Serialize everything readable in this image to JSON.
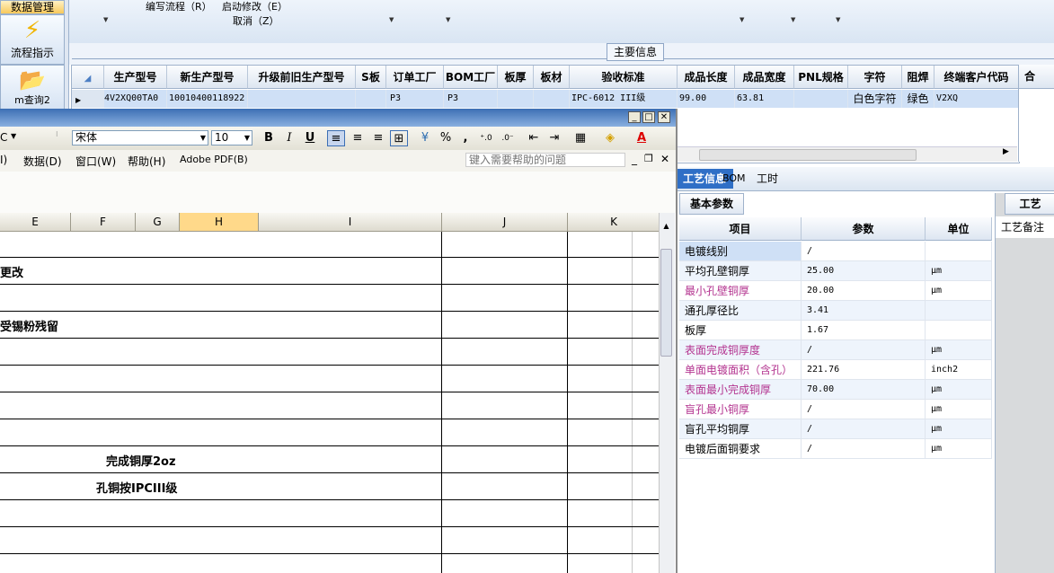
{
  "nav": {
    "btn1_label": "数据管理",
    "btn2_label": "流程指示",
    "btn3_label": "m查询2"
  },
  "topmenu": {
    "write_flow": "编写流程（R）",
    "start_modify": "启动修改（E）",
    "cancel": "取消（Z）"
  },
  "info": {
    "section_title": "主要信息",
    "columns": [
      "生产型号",
      "新生产型号",
      "升级前旧生产型号",
      "S板",
      "订单工厂",
      "BOM工厂",
      "板厚",
      "板材",
      "验收标准",
      "成品长度",
      "成品宽度",
      "PNL规格",
      "字符",
      "阻焊",
      "终端客户代码",
      "合"
    ],
    "row": [
      "4V2XQ00TA0",
      "10010400118922",
      "",
      "",
      "P3",
      "P3",
      "",
      "",
      "IPC-6012 III级",
      "99.00",
      "63.81",
      "",
      "白色字符",
      "绿色",
      "V2XQ",
      ""
    ]
  },
  "detail": {
    "tabs": [
      "工艺信息",
      "BOM",
      "工时"
    ],
    "basic_tab": "基本参数",
    "process_tab": "工艺",
    "process_note": "工艺备注",
    "headers": [
      "项目",
      "参数",
      "单位"
    ],
    "rows": [
      {
        "item": "电镀线别",
        "value": "/",
        "unit": ""
      },
      {
        "item": "平均孔壁铜厚",
        "value": "25.00",
        "unit": "μm"
      },
      {
        "item": "最小孔壁铜厚",
        "value": "20.00",
        "unit": "μm"
      },
      {
        "item": "通孔厚径比",
        "value": "3.41",
        "unit": ""
      },
      {
        "item": "板厚",
        "value": "1.67",
        "unit": ""
      },
      {
        "item": "表面完成铜厚度",
        "value": "/",
        "unit": "μm"
      },
      {
        "item": "单面电镀面积（含孔）",
        "value": "221.76",
        "unit": "inch2"
      },
      {
        "item": "表面最小完成铜厚",
        "value": "70.00",
        "unit": "μm"
      },
      {
        "item": "盲孔最小铜厚",
        "value": "/",
        "unit": "μm"
      },
      {
        "item": "盲孔平均铜厚",
        "value": "/",
        "unit": "μm"
      },
      {
        "item": "电镀后面铜要求",
        "value": "/",
        "unit": "μm"
      }
    ],
    "colors": {
      "highlight": "#b3338f",
      "normal": "#000000",
      "tab_selected": "#2f6fc6"
    }
  },
  "excel": {
    "font_name": "宋体",
    "font_size": "10",
    "font_name_left": "C",
    "bold": "B",
    "italic": "I",
    "underline": "U",
    "percent": "%",
    "comma": ",",
    "menu": [
      "I)",
      "数据(D)",
      "窗口(W)",
      "帮助(H)",
      "Adobe PDF(B)"
    ],
    "help_placeholder": "键入需要帮助的问题",
    "columns": [
      "E",
      "F",
      "G",
      "H",
      "I",
      "J",
      "K"
    ],
    "cell_texts": [
      "更改",
      "受锡粉残留",
      "完成铜厚2oz",
      "孔铜按IPCIII级"
    ]
  }
}
